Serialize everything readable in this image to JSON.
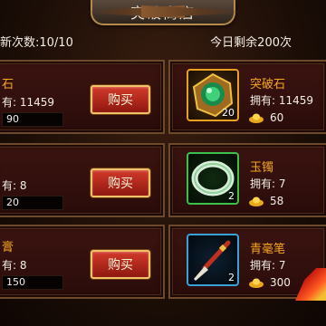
{
  "header": {
    "title": "突破商店",
    "refresh_count": "新次数:10/10",
    "remaining_today": "今日剩余200次"
  },
  "left_items": [
    {
      "name": "石",
      "owned": "有: 11459",
      "price": "90",
      "buy_label": "购买"
    },
    {
      "name": "",
      "owned": "有: 8",
      "price": "20",
      "buy_label": "购买"
    },
    {
      "name": "膏",
      "owned": "有: 8",
      "price": "150",
      "buy_label": "购买"
    }
  ],
  "right_items": [
    {
      "name": "突破石",
      "owned": "拥有: 11459",
      "count": "20",
      "price": "60",
      "icon": "breakthrough-stone-icon",
      "border_color": "#e8a020"
    },
    {
      "name": "玉镯",
      "owned": "拥有: 7",
      "count": "2",
      "price": "58",
      "icon": "jade-bracelet-icon",
      "border_color": "#3cc04a"
    },
    {
      "name": "青毫笔",
      "owned": "拥有: 7",
      "count": "2",
      "price": "300",
      "icon": "brush-pen-icon",
      "border_color": "#3aa0d8"
    }
  ],
  "colors": {
    "item_name": "#f5a623",
    "buy_button": "#c02818",
    "gold_border": "#e8a020",
    "green_border": "#3cc04a",
    "blue_border": "#3aa0d8"
  }
}
